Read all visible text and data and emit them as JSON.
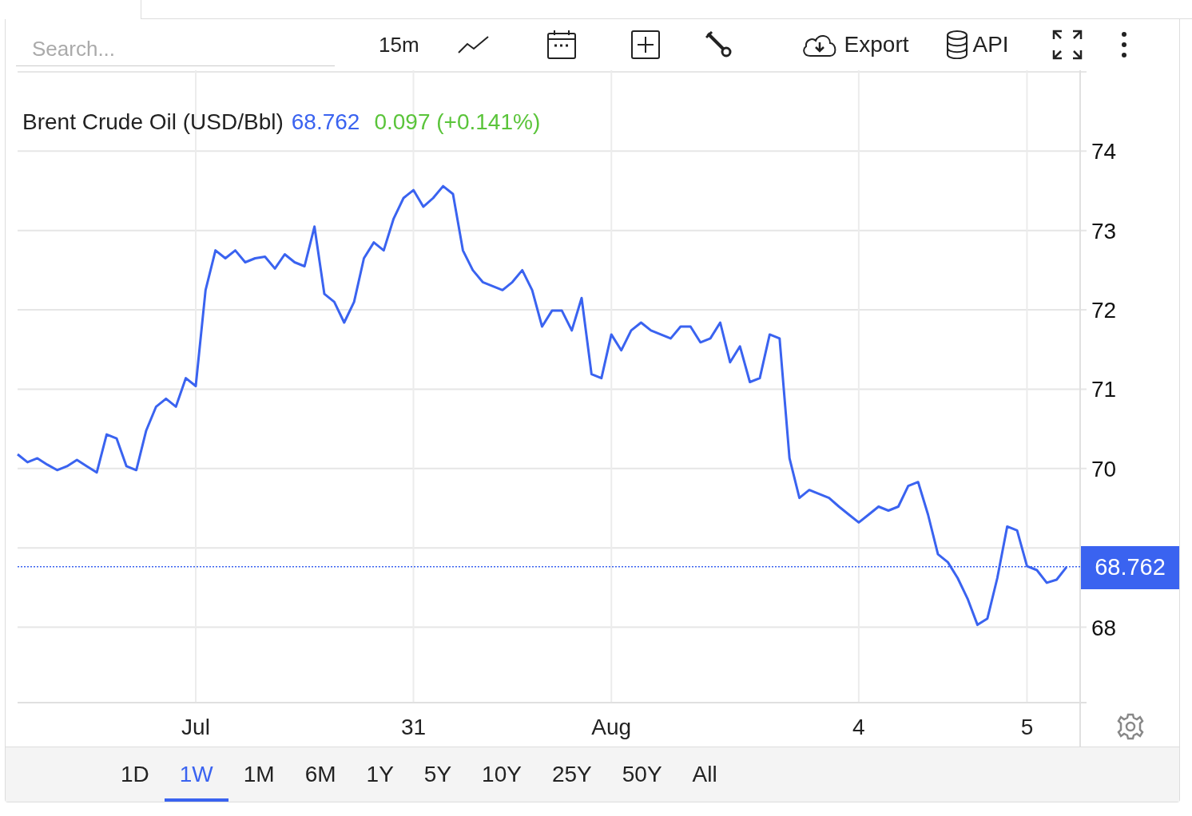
{
  "toolbar": {
    "search": {
      "placeholder": "Search..."
    },
    "interval": "15m",
    "export_label": "Export",
    "api_label": "API"
  },
  "legend": {
    "title": "Brent Crude Oil (USD/Bbl)",
    "price": "68.762",
    "change": "0.097 (+0.141%)"
  },
  "last_price_badge": "68.762",
  "chart_data": {
    "type": "line",
    "grid": true,
    "ylim": [
      67.05,
      75.02
    ],
    "ref_lines": [
      {
        "axis": "y",
        "value": 68.762,
        "color": "#3a63f0"
      }
    ],
    "categories": [
      null,
      null,
      null,
      null,
      null,
      null,
      null,
      null,
      null,
      null,
      null,
      null,
      null,
      null,
      null,
      null,
      null,
      null,
      "Jul",
      null,
      null,
      null,
      null,
      null,
      null,
      null,
      null,
      null,
      null,
      null,
      null,
      null,
      null,
      null,
      null,
      null,
      null,
      null,
      null,
      null,
      "31",
      null,
      null,
      null,
      null,
      null,
      null,
      null,
      null,
      null,
      null,
      null,
      null,
      null,
      null,
      null,
      null,
      null,
      null,
      null,
      "Aug",
      null,
      null,
      null,
      null,
      null,
      null,
      null,
      null,
      null,
      null,
      null,
      null,
      null,
      null,
      null,
      null,
      null,
      null,
      null,
      null,
      null,
      null,
      null,
      null,
      "4",
      null,
      null,
      null,
      null,
      null,
      null,
      null,
      null,
      null,
      null,
      null,
      null,
      null,
      null,
      null,
      null,
      "5",
      null,
      null,
      null,
      null
    ],
    "yticks": [
      68,
      70,
      71,
      72,
      73,
      74
    ],
    "series": [
      {
        "color": "#3a63f0",
        "values": [
          70.18,
          70.08,
          70.13,
          70.05,
          69.98,
          70.03,
          70.11,
          70.03,
          69.95,
          70.43,
          70.38,
          70.03,
          69.98,
          70.48,
          70.78,
          70.88,
          70.78,
          71.14,
          71.04,
          72.25,
          72.75,
          72.65,
          72.75,
          72.6,
          72.65,
          72.67,
          72.52,
          72.7,
          72.6,
          72.55,
          73.05,
          72.2,
          72.1,
          71.84,
          72.1,
          72.65,
          72.85,
          72.75,
          73.15,
          73.41,
          73.51,
          73.3,
          73.41,
          73.56,
          73.46,
          72.75,
          72.5,
          72.35,
          72.3,
          72.25,
          72.35,
          72.5,
          72.25,
          71.79,
          71.99,
          71.99,
          71.74,
          72.15,
          71.19,
          71.14,
          71.69,
          71.49,
          71.74,
          71.84,
          71.74,
          71.69,
          71.64,
          71.79,
          71.79,
          71.59,
          71.64,
          71.84,
          71.34,
          71.54,
          71.09,
          71.14,
          71.69,
          71.64,
          70.13,
          69.63,
          69.73,
          69.68,
          69.63,
          69.52,
          69.42,
          69.32,
          69.42,
          69.52,
          69.47,
          69.52,
          69.78,
          69.83,
          69.42,
          68.92,
          68.82,
          68.62,
          68.36,
          68.03,
          68.11,
          68.62,
          69.27,
          69.22,
          68.77,
          68.72,
          68.56,
          68.6,
          68.76
        ]
      }
    ]
  },
  "ranges": [
    {
      "label": "1D",
      "selected": false
    },
    {
      "label": "1W",
      "selected": true
    },
    {
      "label": "1M",
      "selected": false
    },
    {
      "label": "6M",
      "selected": false
    },
    {
      "label": "1Y",
      "selected": false
    },
    {
      "label": "5Y",
      "selected": false
    },
    {
      "label": "10Y",
      "selected": false
    },
    {
      "label": "25Y",
      "selected": false
    },
    {
      "label": "50Y",
      "selected": false
    },
    {
      "label": "All",
      "selected": false
    }
  ]
}
